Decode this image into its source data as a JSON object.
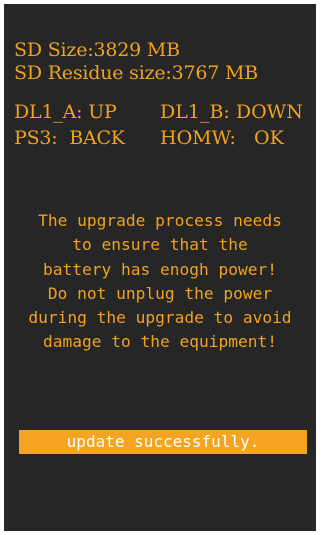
{
  "sd": {
    "size_label": "SD Size:",
    "size_value": "3829",
    "size_unit": "MB",
    "residue_label": "SD Residue size:",
    "residue_value": "3767",
    "residue_unit": "MB"
  },
  "status": {
    "dl1_a_label": "DL1_A:",
    "dl1_a_value": "UP",
    "dl1_b_label": "DL1_B:",
    "dl1_b_value": "DOWN",
    "ps3_label": "PS3:",
    "ps3_value": "BACK",
    "homw_label": "HOMW:",
    "homw_value": "OK"
  },
  "notice": {
    "lines": [
      "The upgrade process needs",
      "to ensure that the",
      "battery has enogh power!",
      "Do not unplug the power",
      "during the upgrade to avoid",
      "damage to the equipment!"
    ]
  },
  "banner": {
    "text": "update successfully."
  },
  "colors": {
    "screen_background": "#262626",
    "text": "#f0a21f",
    "banner_background": "#f4a420",
    "banner_text": "#ffffff"
  }
}
